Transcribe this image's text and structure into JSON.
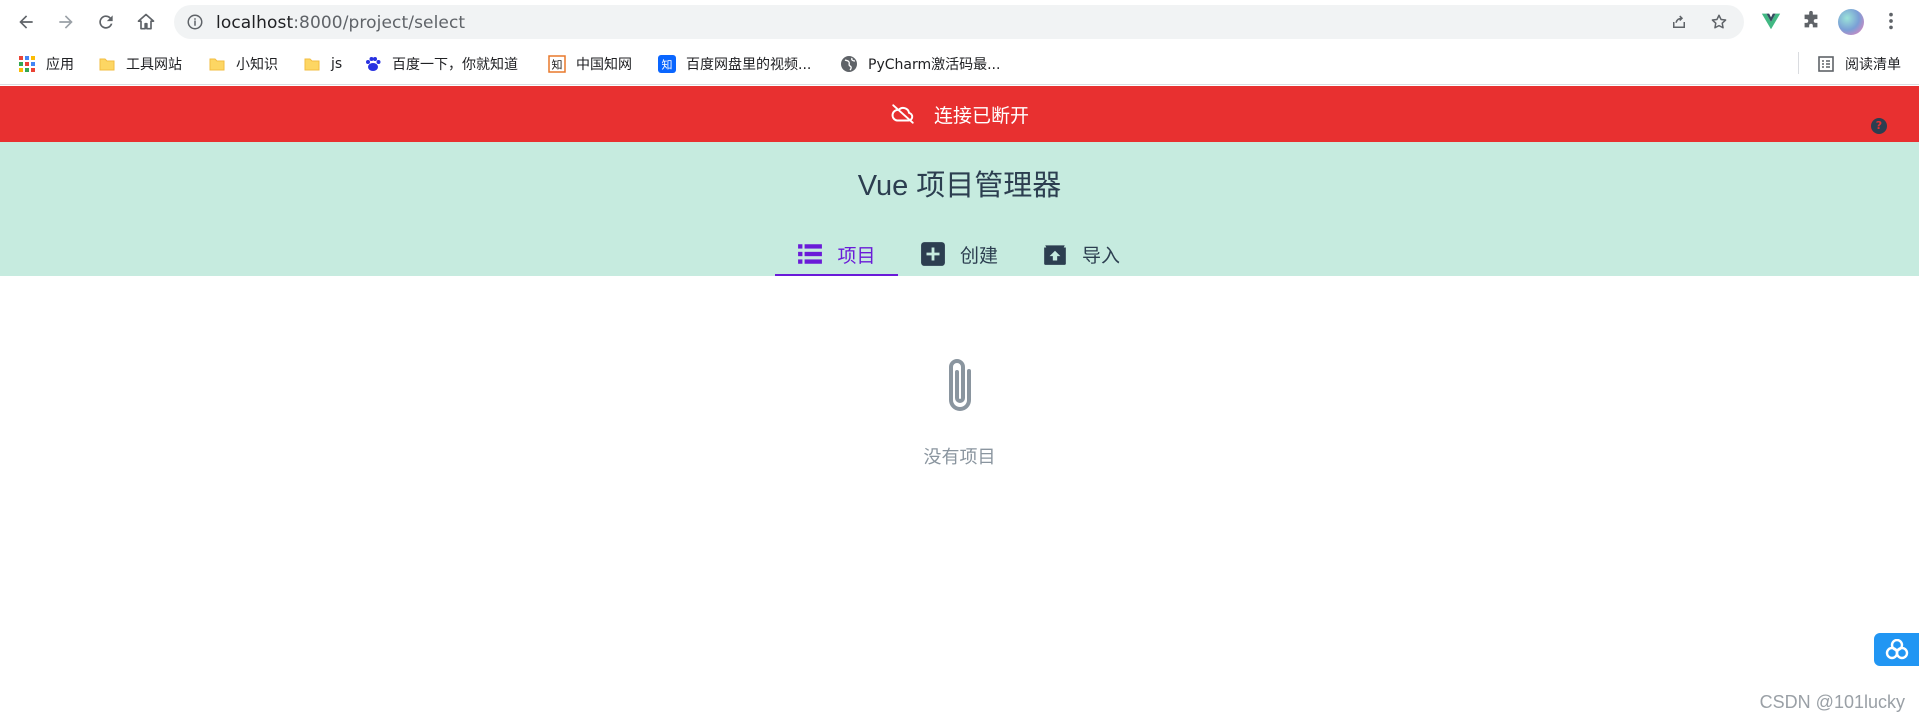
{
  "browser": {
    "url_host": "localhost",
    "url_rest": ":8000/project/select",
    "bookmarks": [
      {
        "label": "应用",
        "icon": "apps-grid-icon"
      },
      {
        "label": "工具网站",
        "icon": "folder-icon"
      },
      {
        "label": "小知识",
        "icon": "folder-icon"
      },
      {
        "label": "js",
        "icon": "folder-icon"
      },
      {
        "label": "百度一下，你就知道",
        "icon": "baidu-paw-icon"
      },
      {
        "label": "中国知网",
        "icon": "cnki-icon"
      },
      {
        "label": "百度网盘里的视频...",
        "icon": "zhihu-icon"
      },
      {
        "label": "PyCharm激活码最...",
        "icon": "globe-icon"
      }
    ],
    "reading_list": "阅读清单"
  },
  "banner": {
    "text": "连接已断开",
    "icon": "cloud-off-icon",
    "color": "#e83030"
  },
  "header": {
    "title": "Vue 项目管理器",
    "background": "#c6ebdf",
    "tabs": [
      {
        "label": "项目",
        "icon": "list-icon",
        "active": true
      },
      {
        "label": "创建",
        "icon": "plus-box-icon",
        "active": false
      },
      {
        "label": "导入",
        "icon": "unarchive-icon",
        "active": false
      }
    ],
    "accent": "#6a1bd8"
  },
  "empty_state": {
    "icon": "paperclip-icon",
    "message": "没有项目"
  },
  "watermark": "CSDN @101lucky"
}
